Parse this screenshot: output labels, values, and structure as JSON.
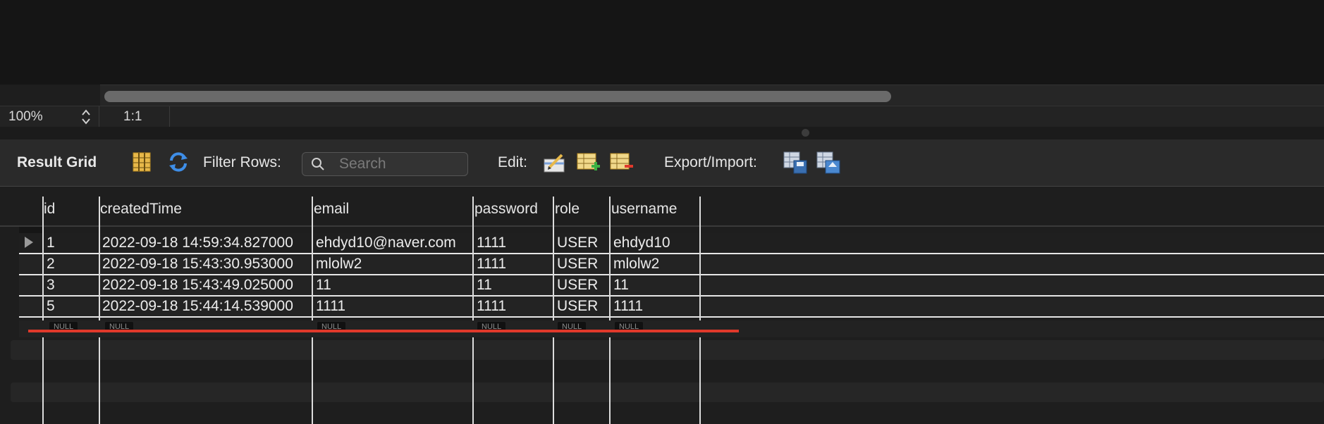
{
  "status": {
    "zoom": "100%",
    "position": "1:1"
  },
  "toolbar": {
    "result_grid_label": "Result Grid",
    "filter_label": "Filter Rows:",
    "search_placeholder": "Search",
    "edit_label": "Edit:",
    "export_label": "Export/Import:"
  },
  "columns": [
    "id",
    "createdTime",
    "email",
    "password",
    "role",
    "username"
  ],
  "rows": [
    [
      "1",
      "2022-09-18 14:59:34.827000",
      "ehdyd10@naver.com",
      "1111",
      "USER",
      "ehdyd10"
    ],
    [
      "2",
      "2022-09-18 15:43:30.953000",
      "mlolw2",
      "1111",
      "USER",
      "mlolw2"
    ],
    [
      "3",
      "2022-09-18 15:43:49.025000",
      "11",
      "11",
      "USER",
      "11"
    ],
    [
      "5",
      "2022-09-18 15:44:14.539000",
      "1111",
      "1111",
      "USER",
      "1111"
    ]
  ],
  "null_label": "NULL",
  "colors": {
    "annotation": "#e0392b",
    "grid_line": "#dcdcdc"
  }
}
